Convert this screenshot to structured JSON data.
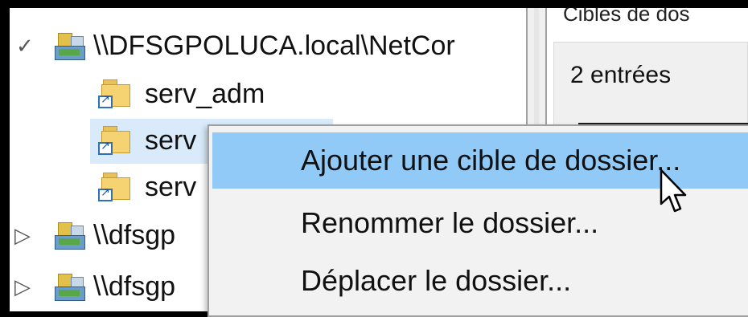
{
  "tree": {
    "root": {
      "label": "\\\\DFSGPOLUCA.local\\NetCor",
      "expander": "✓"
    },
    "folders": [
      {
        "label": "serv_adm"
      },
      {
        "label": "serv"
      },
      {
        "label": "serv"
      }
    ],
    "other_namespaces": [
      {
        "label": "\\\\dfsgp",
        "expander": "▷"
      },
      {
        "label": "\\\\dfsgp",
        "expander": "▷"
      }
    ]
  },
  "details": {
    "header": "Cibles de dos",
    "count": "2 entrées"
  },
  "context_menu": {
    "items": [
      {
        "label": "Ajouter une cible de dossier...",
        "highlighted": true
      },
      {
        "label": "Renommer le dossier...",
        "highlighted": false
      },
      {
        "label": "Déplacer le dossier...",
        "highlighted": false
      }
    ]
  },
  "colors": {
    "selection": "#d9ebfa",
    "menu_highlight": "#91c9f7",
    "menu_background": "#f2f2f2"
  }
}
